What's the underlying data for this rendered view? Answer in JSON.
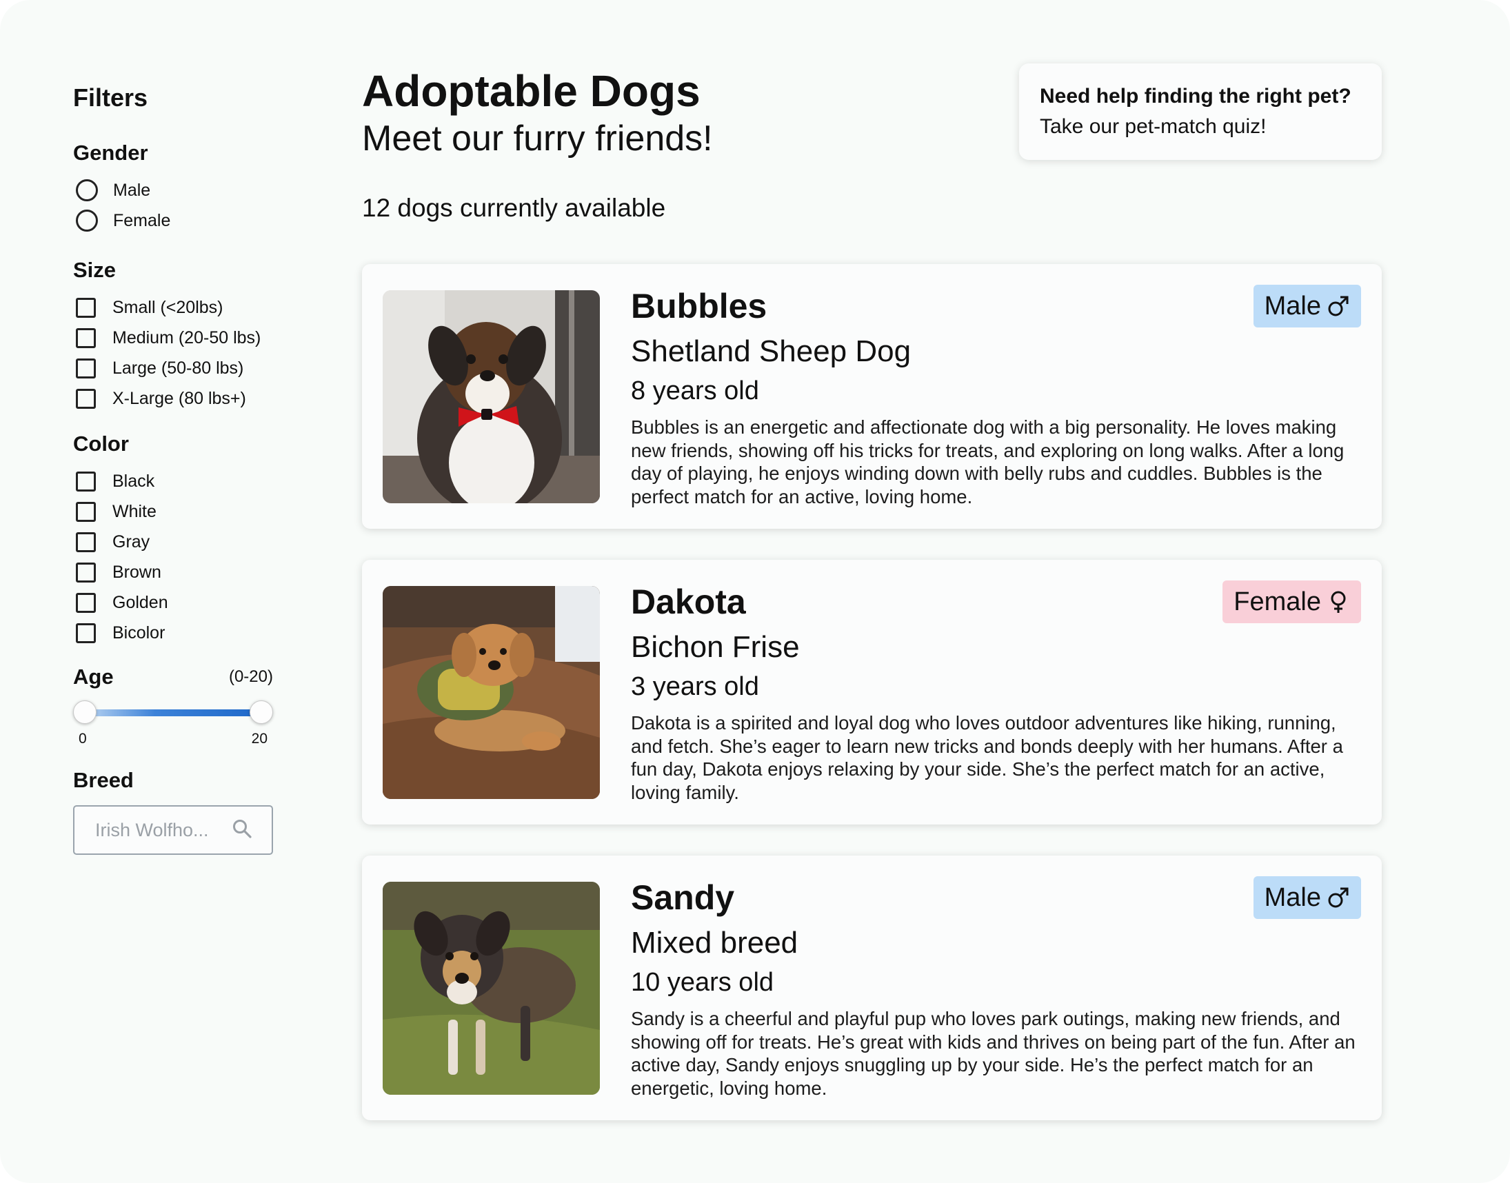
{
  "sidebar": {
    "title": "Filters",
    "gender": {
      "title": "Gender",
      "options": [
        "Male",
        "Female"
      ]
    },
    "size": {
      "title": "Size",
      "options": [
        "Small (<20lbs)",
        "Medium (20-50 lbs)",
        "Large (50-80 lbs)",
        "X-Large (80 lbs+)"
      ]
    },
    "color": {
      "title": "Color",
      "options": [
        "Black",
        "White",
        "Gray",
        "Brown",
        "Golden",
        "Bicolor"
      ]
    },
    "age": {
      "title": "Age",
      "range_label": "(0-20)",
      "min_label": "0",
      "max_label": "20",
      "min": 0,
      "max": 20
    },
    "breed": {
      "title": "Breed",
      "placeholder": "Irish Wolfho..."
    }
  },
  "header": {
    "title": "Adoptable Dogs",
    "subtitle": "Meet our furry friends!",
    "count": "12 dogs currently available"
  },
  "quiz": {
    "question": "Need help finding the right pet?",
    "cta": "Take our pet-match quiz!"
  },
  "dogs": [
    {
      "name": "Bubbles",
      "breed": "Shetland Sheep Dog",
      "age": "8 years old",
      "gender": "Male",
      "description": "Bubbles is an energetic and affectionate dog with a big personality. He loves making new friends, showing off his tricks for treats, and exploring on long walks. After a long day of playing, he enjoys winding down with belly rubs and cuddles. Bubbles is the perfect match for an active, loving home."
    },
    {
      "name": "Dakota",
      "breed": "Bichon Frise",
      "age": "3 years old",
      "gender": "Female",
      "description": "Dakota is a spirited and loyal dog who loves outdoor adventures like hiking, running, and fetch. She’s eager to learn new tricks and bonds deeply with her humans. After a fun day, Dakota enjoys relaxing by your side. She’s the perfect match for an active, loving family."
    },
    {
      "name": "Sandy",
      "breed": "Mixed breed",
      "age": "10 years old",
      "gender": "Male",
      "description": "Sandy is a cheerful and playful pup who loves park outings, making new friends, and showing off for treats. He’s great with kids and thrives on being part of the fun. After an active day, Sandy enjoys snuggling up by your side. He’s the perfect match for an energetic, loving home."
    }
  ],
  "colors": {
    "background": "#f8fbf9",
    "male_badge": "#bcdcf8",
    "female_badge": "#f9cfd8",
    "slider_fill": "#1e68c9"
  },
  "icons": {
    "search": "search-icon",
    "male": "male-symbol-icon",
    "female": "female-symbol-icon"
  }
}
